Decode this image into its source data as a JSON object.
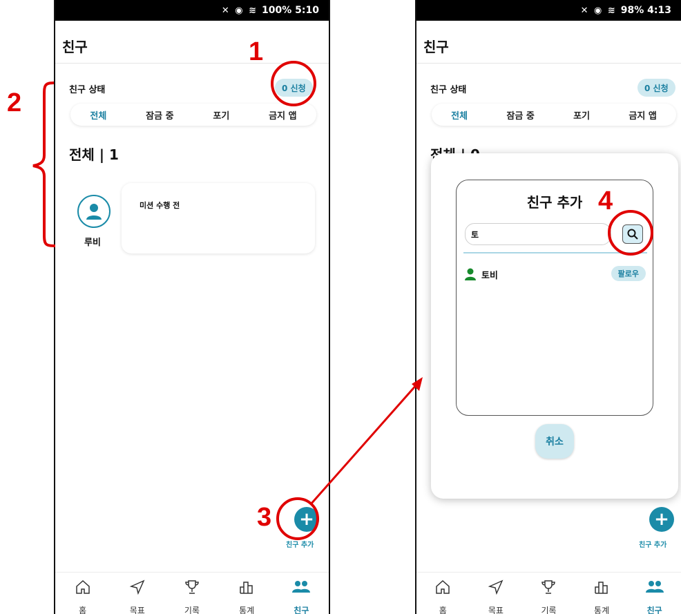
{
  "left_screen": {
    "status": {
      "icons": "✕ ◉ ≋",
      "battery_time": "100% 5:10"
    },
    "page_title": "친구",
    "friend_status_label": "친구 상태",
    "request_badge": "0 신청",
    "tabs": [
      {
        "label": "전체",
        "active": true
      },
      {
        "label": "잠금 중",
        "active": false
      },
      {
        "label": "포기",
        "active": false
      },
      {
        "label": "금지 앱",
        "active": false
      }
    ],
    "count_title": "전체 | 1",
    "friend": {
      "name": "루비",
      "mission_status": "미션 수행 전"
    },
    "fab_label": "친구 추가",
    "bottom_nav": [
      {
        "label": "홈",
        "icon": "home-icon",
        "active": false
      },
      {
        "label": "목표",
        "icon": "send-icon",
        "active": false
      },
      {
        "label": "기록",
        "icon": "trophy-icon",
        "active": false
      },
      {
        "label": "통계",
        "icon": "stats-icon",
        "active": false
      },
      {
        "label": "친구",
        "icon": "friends-icon",
        "active": true
      }
    ]
  },
  "right_screen": {
    "status": {
      "icons": "✕ ◉ ≋",
      "battery_time": "98% 4:13"
    },
    "page_title": "친구",
    "friend_status_label": "친구 상태",
    "request_badge": "0 신청",
    "tabs": [
      {
        "label": "전체",
        "active": true
      },
      {
        "label": "잠금 중",
        "active": false
      },
      {
        "label": "포기",
        "active": false
      },
      {
        "label": "금지 앱",
        "active": false
      }
    ],
    "count_title": "전체 | 0",
    "dialog": {
      "title": "친구 추가",
      "search_value": "토",
      "result_name": "토비",
      "follow_label": "팔로우",
      "cancel_label": "취소"
    },
    "fab_label": "친구 추가",
    "bottom_nav": [
      {
        "label": "홈",
        "icon": "home-icon",
        "active": false
      },
      {
        "label": "목표",
        "icon": "send-icon",
        "active": false
      },
      {
        "label": "기록",
        "icon": "trophy-icon",
        "active": false
      },
      {
        "label": "통계",
        "icon": "stats-icon",
        "active": false
      },
      {
        "label": "친구",
        "icon": "friends-icon",
        "active": true
      }
    ]
  },
  "annotations": {
    "n1": "1",
    "n2": "2",
    "n3": "3",
    "n4": "4",
    "color": "#e00000"
  },
  "colors": {
    "accent": "#1a8ba8",
    "badge_bg": "#cfe9f0"
  }
}
